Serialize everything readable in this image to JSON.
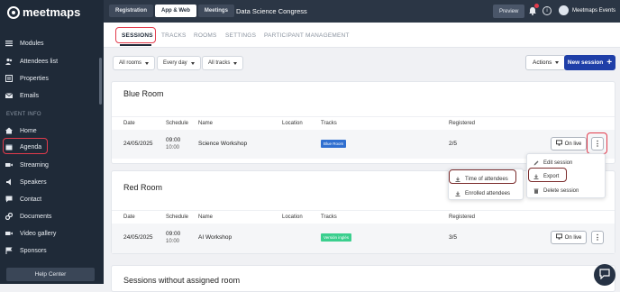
{
  "app": {
    "logo_text": "meetmaps"
  },
  "sidebar": {
    "section_label": "EVENT INFO",
    "help_button": "Help Center",
    "items_top": [
      {
        "label": "Modules",
        "icon": "hamburger-icon"
      },
      {
        "label": "Attendees list",
        "icon": "users-icon"
      },
      {
        "label": "Properties",
        "icon": "list-icon"
      },
      {
        "label": "Emails",
        "icon": "mail-icon"
      }
    ],
    "items_event": [
      {
        "label": "Home",
        "icon": "home-icon"
      },
      {
        "label": "Agenda",
        "icon": "calendar-icon"
      },
      {
        "label": "Streaming",
        "icon": "video-icon"
      },
      {
        "label": "Speakers",
        "icon": "speaker-icon"
      },
      {
        "label": "Contact",
        "icon": "chat-icon"
      },
      {
        "label": "Documents",
        "icon": "link-icon"
      },
      {
        "label": "Video gallery",
        "icon": "video-icon"
      },
      {
        "label": "Sponsors",
        "icon": "flag-icon"
      }
    ]
  },
  "topbar": {
    "tabs": [
      "Registration",
      "App & Web",
      "Meetings"
    ],
    "active_tab": "App & Web",
    "event_title": "Data Science Congress",
    "preview_label": "Preview",
    "bell_badge": "1",
    "user_name": "Meetmaps Events"
  },
  "subnav": {
    "tabs": [
      "SESSIONS",
      "TRACKS",
      "ROOMS",
      "SETTINGS",
      "PARTICIPANT MANAGEMENT"
    ],
    "active_tab": "SESSIONS"
  },
  "filters": {
    "rooms": "All rooms",
    "days": "Every day",
    "tracks": "All tracks",
    "actions": "Actions",
    "new_session": "New session"
  },
  "columns": [
    "Date",
    "Schedule",
    "Name",
    "Location",
    "Tracks",
    "Registered"
  ],
  "rooms": [
    {
      "title": "Blue Room",
      "sessions": [
        {
          "date": "24/05/2025",
          "start": "09:00",
          "end": "10:00",
          "name": "Science Workshop",
          "location": "",
          "track": "Blue Room",
          "track_color": "#2f6fd0",
          "registered": "2/5",
          "onlive": "On live"
        }
      ]
    },
    {
      "title": "Red Room",
      "sessions": [
        {
          "date": "24/05/2025",
          "start": "09:00",
          "end": "10:00",
          "name": "AI Workshop",
          "location": "",
          "track": "Versión inglés",
          "track_color": "#3bcf8e",
          "registered": "3/5",
          "onlive": "On live"
        }
      ]
    }
  ],
  "unassigned_title": "Sessions without assigned room",
  "session_menu": [
    "Edit session",
    "Export",
    "Delete session"
  ],
  "export_submenu": [
    "Time of attendees",
    "Enrolled attendees"
  ],
  "colors": {
    "accent": "#1f3fa8",
    "sidebar": "#1f2a38",
    "highlight": "#e23b4c"
  }
}
